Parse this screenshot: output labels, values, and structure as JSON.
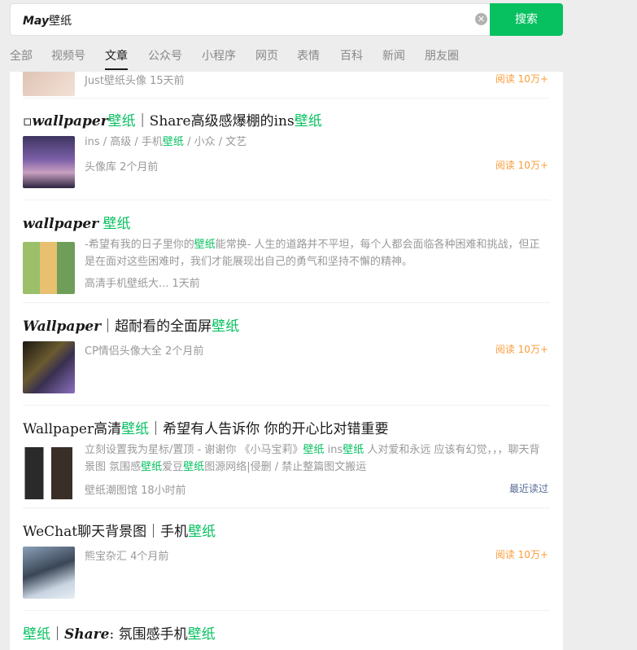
{
  "search": {
    "query_em": "May",
    "query_rest": "壁纸",
    "button_label": "搜索"
  },
  "tabs": [
    "全部",
    "视频号",
    "文章",
    "公众号",
    "小程序",
    "网页",
    "表情",
    "百科",
    "新闻",
    "朋友圈"
  ],
  "partial_item": {
    "meta": "Just壁纸头像  15天前",
    "read": "阅读 10万+"
  },
  "items": [
    {
      "title_parts": [
        "▫",
        "wallpaper",
        "壁纸",
        "｜Share高级感爆棚的ins",
        "壁纸"
      ],
      "desc": [
        "ins / 高级 / 手机",
        "壁纸",
        " / 小众 / 文艺"
      ],
      "meta": "头像库  2个月前",
      "read": "阅读 10万+"
    },
    {
      "title_parts": [
        "wallpaper",
        " ",
        "壁纸"
      ],
      "desc": [
        "-希望有我的日子里你的",
        "壁纸",
        "能常换- 人生的道路并不平坦，每个人都会面临各种困难和挑战，但正是在面对这些困难时，我们才能展现出自己的勇气和坚持不懈的精神。"
      ],
      "meta": "高清手机壁纸大...  1天前",
      "read": ""
    },
    {
      "title_parts": [
        "Wallpaper",
        "｜超耐看的全面屏",
        "壁纸"
      ],
      "meta": "CP情侣头像大全  2个月前",
      "read": "阅读 10万+"
    },
    {
      "title_parts": [
        "Wallpaper高清",
        "壁纸",
        "｜希望有人告诉你 你的开心比对错重要"
      ],
      "desc": [
        "立刻设置我为星标/置顶 - 谢谢你 《小马宝莉》",
        "壁纸",
        " ins",
        "壁纸",
        " 人对爱和永远 应该有幻觉，，，聊天背景图 氛围感",
        "壁纸",
        "爱豆",
        "壁纸",
        "图源网络|侵删 / 禁止整篇图文搬运"
      ],
      "meta": "壁纸潮图馆  18小时前",
      "read": "最近读过"
    },
    {
      "title_parts": [
        "WeChat聊天背景图｜手机",
        "壁纸"
      ],
      "meta": "熊宝杂汇  4个月前",
      "read": "阅读 10万+"
    },
    {
      "title_parts": [
        "壁纸",
        "｜",
        "Share",
        ": 氛围感手机",
        "壁纸"
      ]
    }
  ]
}
